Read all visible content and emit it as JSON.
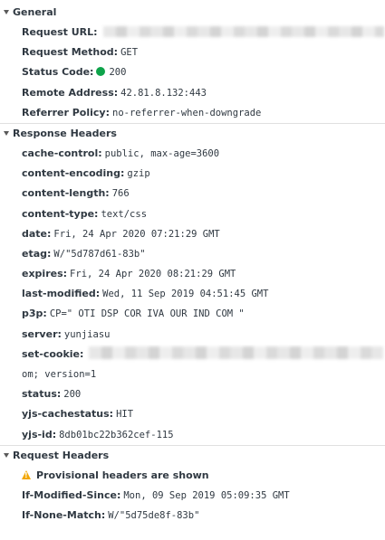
{
  "general": {
    "title": "General",
    "request_url_label": "Request URL:",
    "request_method_label": "Request Method:",
    "request_method_value": "GET",
    "status_code_label": "Status Code:",
    "status_code_value": "200",
    "status_color": "#0ea34a",
    "remote_address_label": "Remote Address:",
    "remote_address_value": "42.81.8.132:443",
    "referrer_policy_label": "Referrer Policy:",
    "referrer_policy_value": "no-referrer-when-downgrade"
  },
  "response_headers": {
    "title": "Response Headers",
    "rows": [
      {
        "key": "cache-control:",
        "value": "public, max-age=3600"
      },
      {
        "key": "content-encoding:",
        "value": "gzip"
      },
      {
        "key": "content-length:",
        "value": "766"
      },
      {
        "key": "content-type:",
        "value": "text/css"
      },
      {
        "key": "date:",
        "value": "Fri, 24 Apr 2020 07:21:29 GMT"
      },
      {
        "key": "etag:",
        "value": "W/\"5d787d61-83b\""
      },
      {
        "key": "expires:",
        "value": "Fri, 24 Apr 2020 08:21:29 GMT"
      },
      {
        "key": "last-modified:",
        "value": "Wed, 11 Sep 2019 04:51:45 GMT"
      },
      {
        "key": "p3p:",
        "value": "CP=\" OTI DSP COR IVA OUR IND COM \""
      },
      {
        "key": "server:",
        "value": "yunjiasu"
      },
      {
        "key": "set-cookie:",
        "value": ""
      },
      {
        "key": "",
        "value": "om; version=1"
      },
      {
        "key": "status:",
        "value": "200"
      },
      {
        "key": "yjs-cachestatus:",
        "value": "HIT"
      },
      {
        "key": "yjs-id:",
        "value": "8db01bc22b362cef-115"
      }
    ]
  },
  "request_headers": {
    "title": "Request Headers",
    "warning": "Provisional headers are shown",
    "warning_color": "#f2a600",
    "rows": [
      {
        "key": "If-Modified-Since:",
        "value": "Mon, 09 Sep 2019 05:09:35 GMT"
      },
      {
        "key": "If-None-Match:",
        "value": "W/\"5d75de8f-83b\""
      }
    ]
  }
}
